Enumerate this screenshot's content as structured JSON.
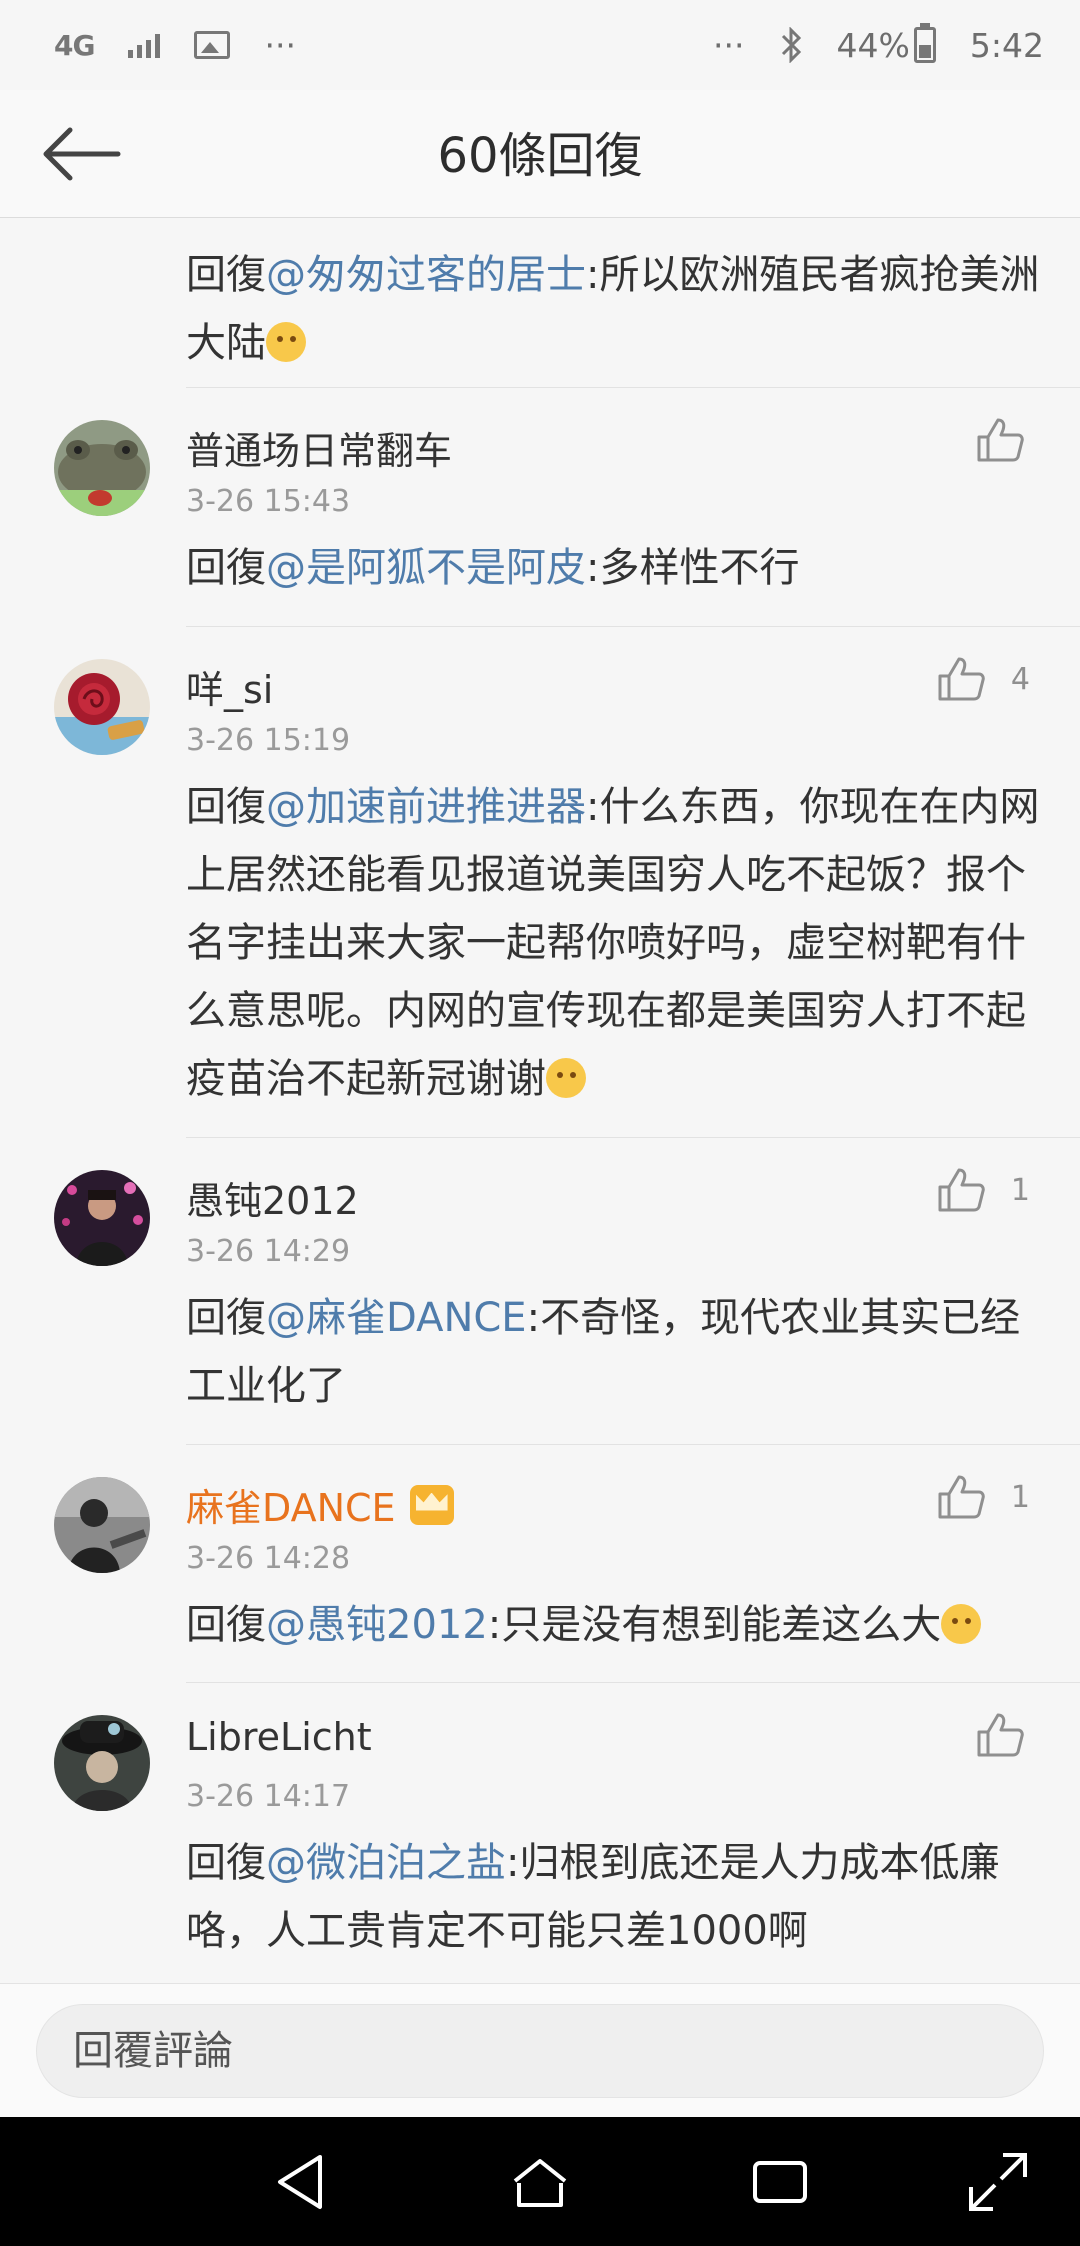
{
  "status_bar": {
    "network": "4G",
    "more_left": "···",
    "more_right": "···",
    "battery": "44%",
    "time": "5:42"
  },
  "header": {
    "title": "60條回復"
  },
  "reply_prefix": "回復",
  "top_reply": {
    "mention": "@匆匆过客的居士",
    "text": ":所以欧洲殖民者疯抢美洲大陆",
    "emoji": "smiling-face-emoji"
  },
  "comments": [
    {
      "username": "普通场日常翻车",
      "time": "3-26 15:43",
      "mention": "@是阿狐不是阿皮",
      "text": ":多样性不行",
      "likes": "",
      "avatar": "frog-avatar"
    },
    {
      "username": "咩_si",
      "time": "3-26 15:19",
      "mention": "@加速前进推进器",
      "text": ":什么东西，你现在在内网上居然还能看见报道说美国穷人吃不起饭？报个名字挂出来大家一起帮你喷好吗，虚空树靶有什么意思呢。内网的宣传现在都是美国穷人打不起疫苗治不起新冠谢谢",
      "likes": "4",
      "avatar": "rose-avatar"
    },
    {
      "username": "愚钝2012",
      "time": "3-26 14:29",
      "mention": "@麻雀DANCE",
      "text": ":不奇怪，现代农业其实已经工业化了",
      "likes": "1",
      "avatar": "person-avatar"
    },
    {
      "username": "麻雀DANCE",
      "time": "3-26 14:28",
      "mention": "@愚钝2012",
      "text": ":只是没有想到能差这么大",
      "likes": "1",
      "avatar": "photo-avatar"
    },
    {
      "username": "LibreLicht",
      "time": "3-26 14:17",
      "mention": "@微泊泊之盐",
      "text": ":归根到底还是人力成本低廉咯，人工贵肯定不可能只差1000啊",
      "likes": "",
      "avatar": "hat-avatar"
    }
  ],
  "reply_bar": {
    "placeholder": "回覆評論"
  },
  "colors": {
    "mention": "#4f7cab",
    "vip_name": "#e8731e",
    "background": "#f6f6f6",
    "meta": "#9a9a9a"
  }
}
